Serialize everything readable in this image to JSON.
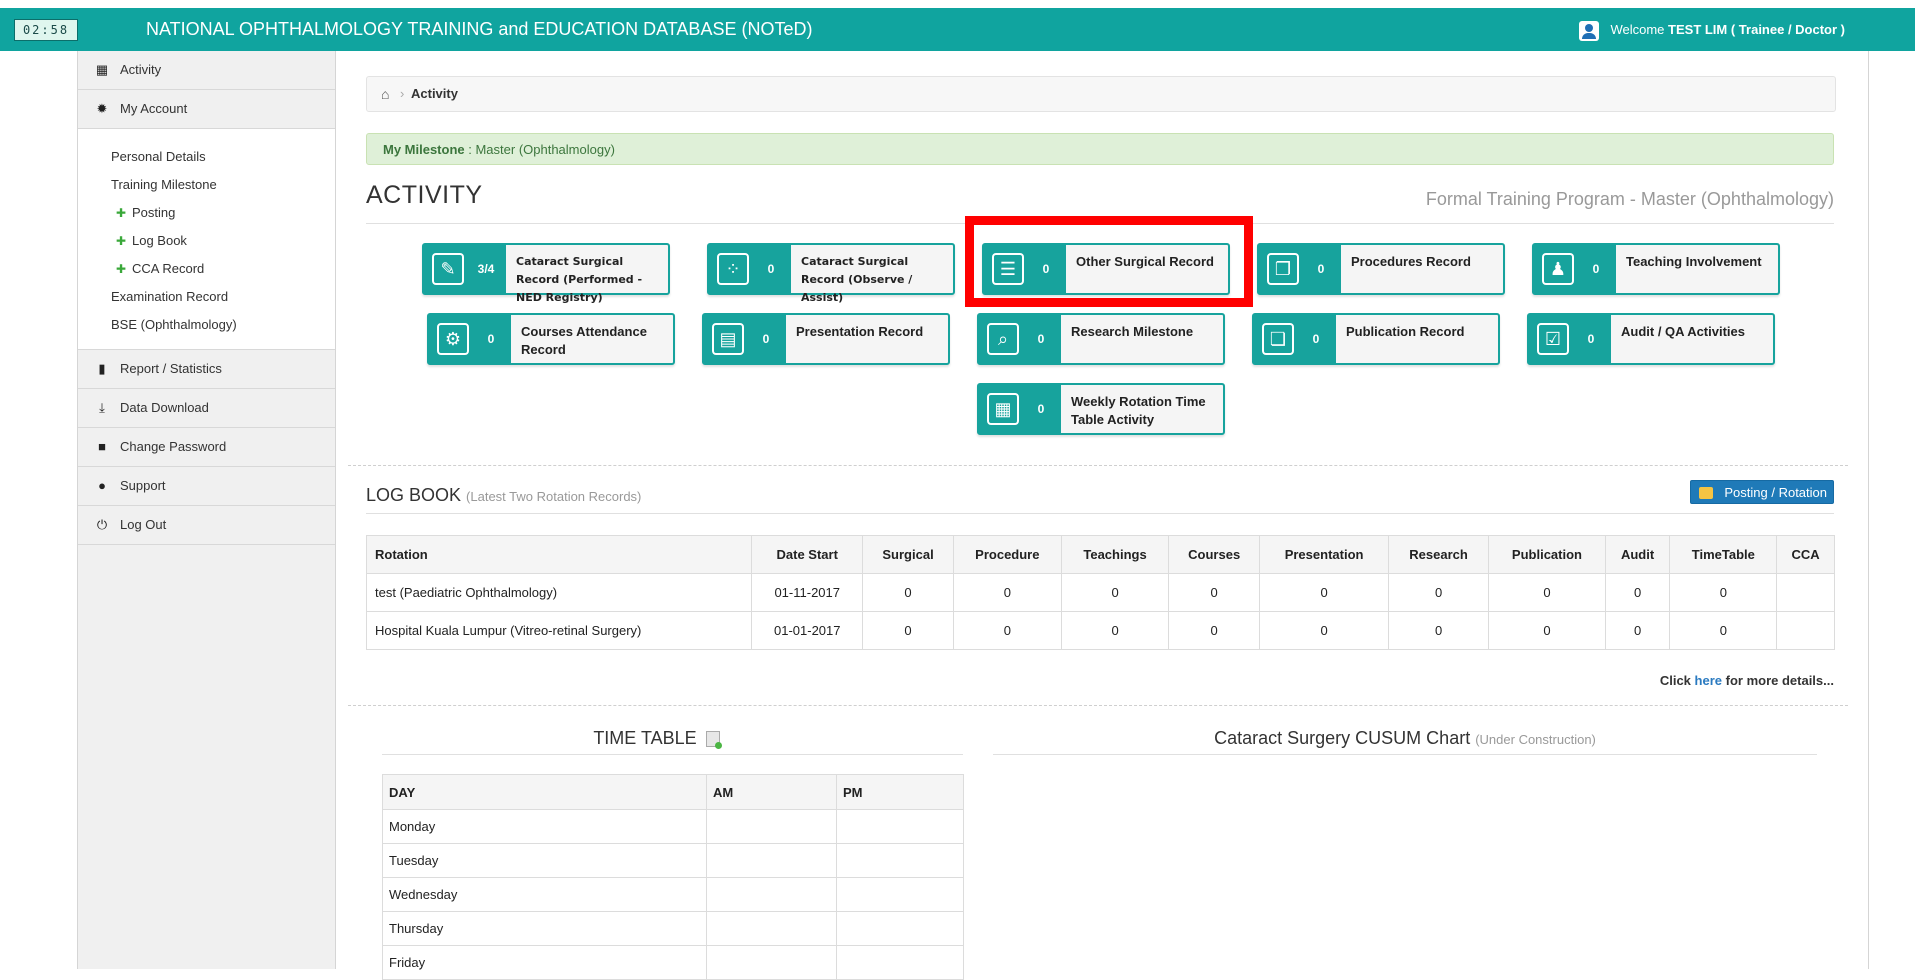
{
  "topbar": {
    "clock": "02:58",
    "title": "NATIONAL OPHTHALMOLOGY TRAINING and EDUCATION DATABASE (NOTeD)",
    "welcome_prefix": "Welcome",
    "welcome_name": "TEST LIM ( Trainee / Doctor )"
  },
  "sidebar": {
    "activity": "Activity",
    "my_account": "My Account",
    "sub": {
      "personal_details": "Personal Details",
      "training_milestone": "Training Milestone",
      "posting": "Posting",
      "log_book": "Log Book",
      "cca_record": "CCA Record",
      "examination_record": "Examination Record",
      "bse": "BSE (Ophthalmology)"
    },
    "report": "Report / Statistics",
    "data_download": "Data Download",
    "change_password": "Change Password",
    "support": "Support",
    "log_out": "Log Out"
  },
  "breadcrumb": {
    "current": "Activity"
  },
  "milestone": {
    "label": "My Milestone",
    "value": ": Master (Ophthalmology)"
  },
  "activity": {
    "title": "ACTIVITY",
    "program": "Formal Training Program - Master (Ophthalmology)",
    "tiles": [
      {
        "label": "Cataract Surgical Record (Performed - NED Registry)",
        "count": "3/4"
      },
      {
        "label": "Cataract Surgical Record (Observe / Assist)",
        "count": "0"
      },
      {
        "label": "Other Surgical Record",
        "count": "0"
      },
      {
        "label": "Procedures Record",
        "count": "0"
      },
      {
        "label": "Teaching Involvement",
        "count": "0"
      },
      {
        "label": "Courses Attendance Record",
        "count": "0"
      },
      {
        "label": "Presentation Record",
        "count": "0"
      },
      {
        "label": "Research Milestone",
        "count": "0"
      },
      {
        "label": "Publication Record",
        "count": "0"
      },
      {
        "label": "Audit / QA Activities",
        "count": "0"
      },
      {
        "label": "Weekly Rotation Time Table Activity",
        "count": "0"
      }
    ]
  },
  "logbook": {
    "title": "LOG BOOK",
    "subtitle": "(Latest Two Rotation Records)",
    "button": "Posting / Rotation",
    "headers": [
      "Rotation",
      "Date Start",
      "Surgical",
      "Procedure",
      "Teachings",
      "Courses",
      "Presentation",
      "Research",
      "Publication",
      "Audit",
      "TimeTable",
      "CCA"
    ],
    "rows": [
      [
        "test (Paediatric Ophthalmology)",
        "01-11-2017",
        "0",
        "0",
        "0",
        "0",
        "0",
        "0",
        "0",
        "0",
        "0",
        ""
      ],
      [
        "Hospital Kuala Lumpur (Vitreo-retinal Surgery)",
        "01-01-2017",
        "0",
        "0",
        "0",
        "0",
        "0",
        "0",
        "0",
        "0",
        "0",
        ""
      ]
    ],
    "more_prefix": "Click",
    "more_link": "here",
    "more_suffix": "for more details..."
  },
  "timetable": {
    "title": "TIME TABLE",
    "headers": [
      "DAY",
      "AM",
      "PM"
    ],
    "days": [
      "Monday",
      "Tuesday",
      "Wednesday",
      "Thursday",
      "Friday"
    ]
  },
  "cusum": {
    "title": "Cataract Surgery CUSUM Chart",
    "note": "(Under Construction)"
  }
}
